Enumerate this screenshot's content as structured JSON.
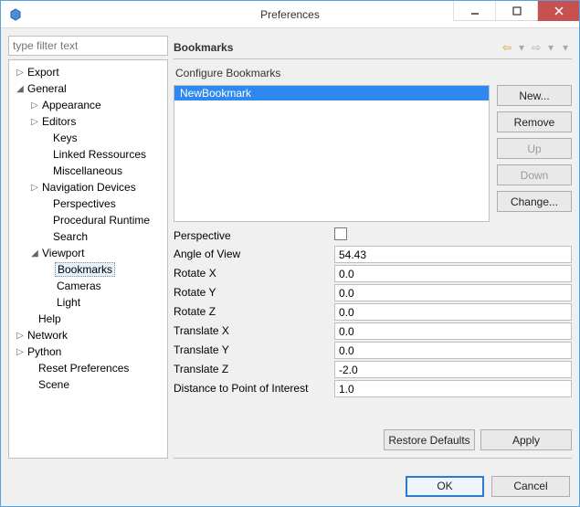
{
  "window": {
    "title": "Preferences"
  },
  "filter": {
    "placeholder": "type filter text"
  },
  "tree": {
    "export": "Export",
    "general": "General",
    "appearance": "Appearance",
    "editors": "Editors",
    "keys": "Keys",
    "linked_resources": "Linked Ressources",
    "miscellaneous": "Miscellaneous",
    "navigation_devices": "Navigation Devices",
    "perspectives": "Perspectives",
    "procedural_runtime": "Procedural Runtime",
    "search": "Search",
    "viewport": "Viewport",
    "bookmarks": "Bookmarks",
    "cameras": "Cameras",
    "light": "Light",
    "help": "Help",
    "network": "Network",
    "python": "Python",
    "reset_preferences": "Reset Preferences",
    "scene": "Scene"
  },
  "section": {
    "title": "Bookmarks",
    "subtitle": "Configure Bookmarks"
  },
  "bookmarks": {
    "items": [
      "NewBookmark"
    ]
  },
  "buttons": {
    "new": "New...",
    "remove": "Remove",
    "up": "Up",
    "down": "Down",
    "change": "Change...",
    "restore_defaults": "Restore Defaults",
    "apply": "Apply",
    "ok": "OK",
    "cancel": "Cancel"
  },
  "props": {
    "perspective_label": "Perspective",
    "angle_label": "Angle of View",
    "angle_value": "54.43",
    "rotx_label": "Rotate X",
    "rotx_value": "0.0",
    "roty_label": "Rotate Y",
    "roty_value": "0.0",
    "rotz_label": "Rotate Z",
    "rotz_value": "0.0",
    "tx_label": "Translate X",
    "tx_value": "0.0",
    "ty_label": "Translate Y",
    "ty_value": "0.0",
    "tz_label": "Translate Z",
    "tz_value": "-2.0",
    "dist_label": "Distance to Point of Interest",
    "dist_value": "1.0"
  }
}
